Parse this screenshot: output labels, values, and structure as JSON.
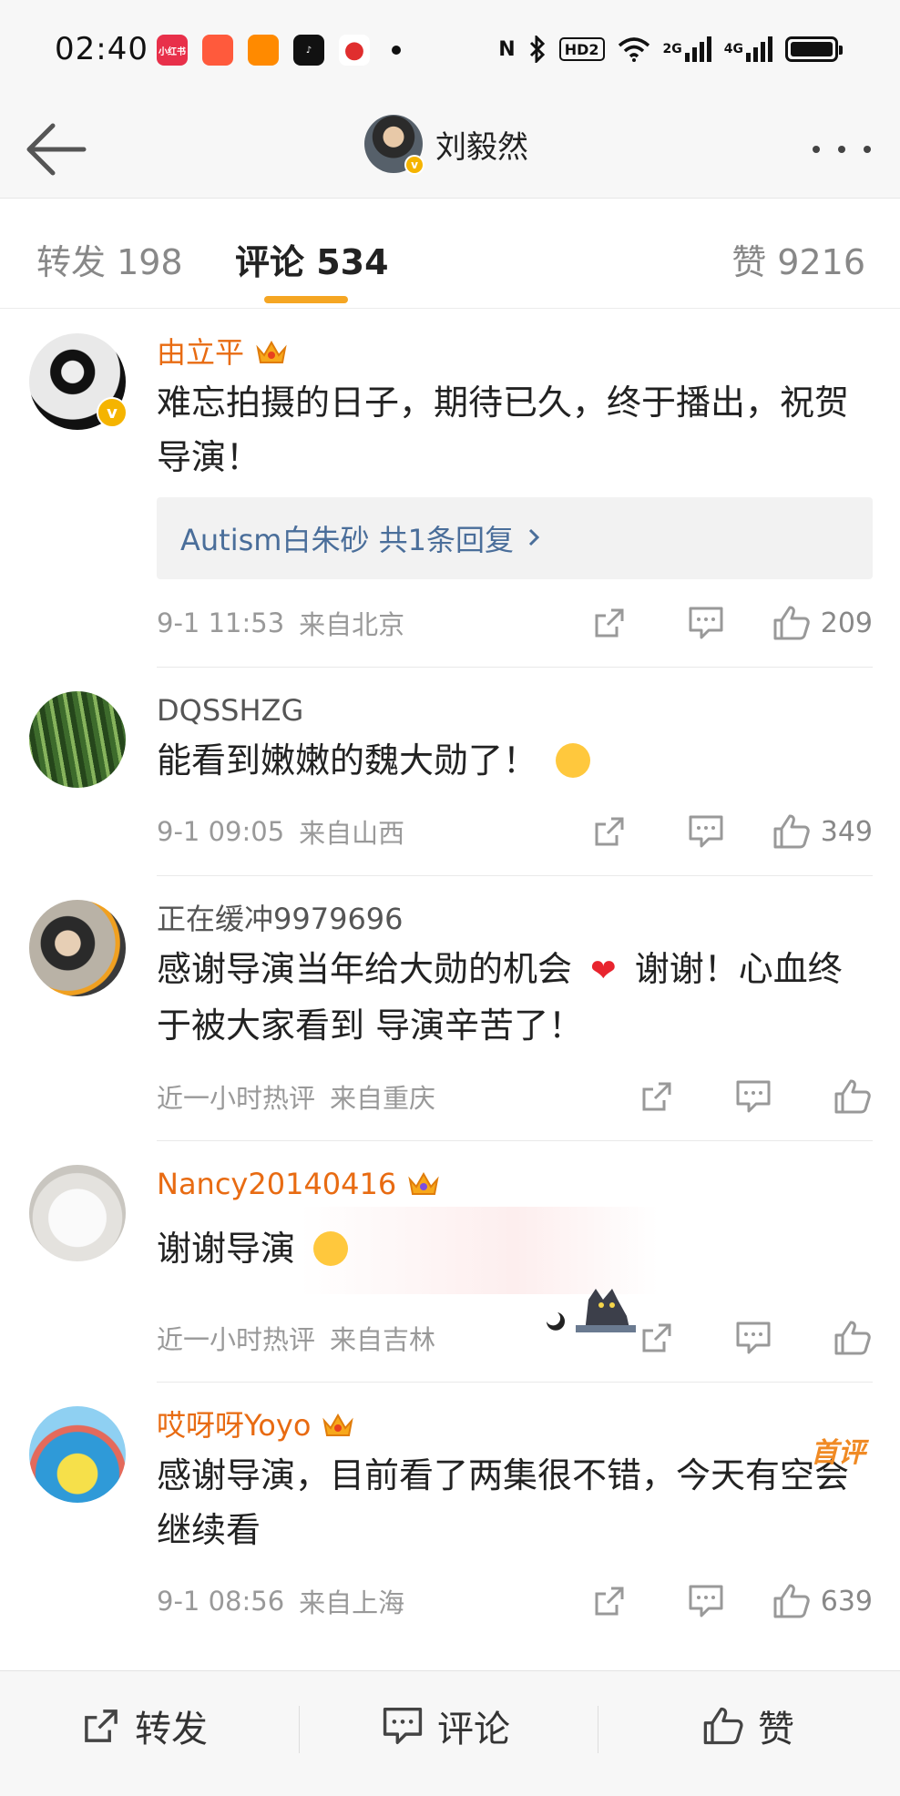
{
  "status_bar": {
    "time": "02:40",
    "apps": [
      "小红书",
      "",
      "",
      "",
      ""
    ],
    "indicators": [
      "N",
      "HD2",
      "2G",
      "4G"
    ]
  },
  "header": {
    "title": "刘毅然",
    "back_icon": "arrow-left-icon",
    "more_icon": "ellipsis-icon"
  },
  "tabs": [
    {
      "label": "转发 198",
      "active": false
    },
    {
      "label": "评论 534",
      "active": true
    },
    {
      "label": "赞 9216",
      "active": false
    }
  ],
  "accent_color": "#f5a623",
  "comments": [
    {
      "name": "由立平",
      "vip": true,
      "verified": true,
      "text": "难忘拍摄的日子，期待已久，终于播出，祝贺导演！",
      "replies": "Autism白朱砂  共1条回复",
      "time": "9-1 11:53",
      "location": "来自北京",
      "likes": "209"
    },
    {
      "name": "DQSSHZG",
      "vip": false,
      "text": "能看到嫩嫩的魏大勋了！",
      "time": "9-1 09:05",
      "location": "来自山西",
      "likes": "349"
    },
    {
      "name": "正在缓冲9979696",
      "vip": false,
      "text_a": "感谢导演当年给大勋的机会",
      "text_b": "谢谢！心血终于被大家看到 导演辛苦了！",
      "time": "近一小时热评",
      "location": "来自重庆",
      "likes": ""
    },
    {
      "name": "Nancy20140416",
      "vip": true,
      "text": "谢谢导演",
      "time": "近一小时热评",
      "location": "来自吉林",
      "likes": ""
    },
    {
      "name": "哎呀呀Yoyo",
      "vip": true,
      "badge": "首评",
      "text": "感谢导演，目前看了两集很不错，今天有空会继续看",
      "time": "9-1 08:56",
      "location": "来自上海",
      "likes": "639"
    }
  ],
  "bottom_bar": {
    "repost": "转发",
    "comment": "评论",
    "like": "赞"
  }
}
